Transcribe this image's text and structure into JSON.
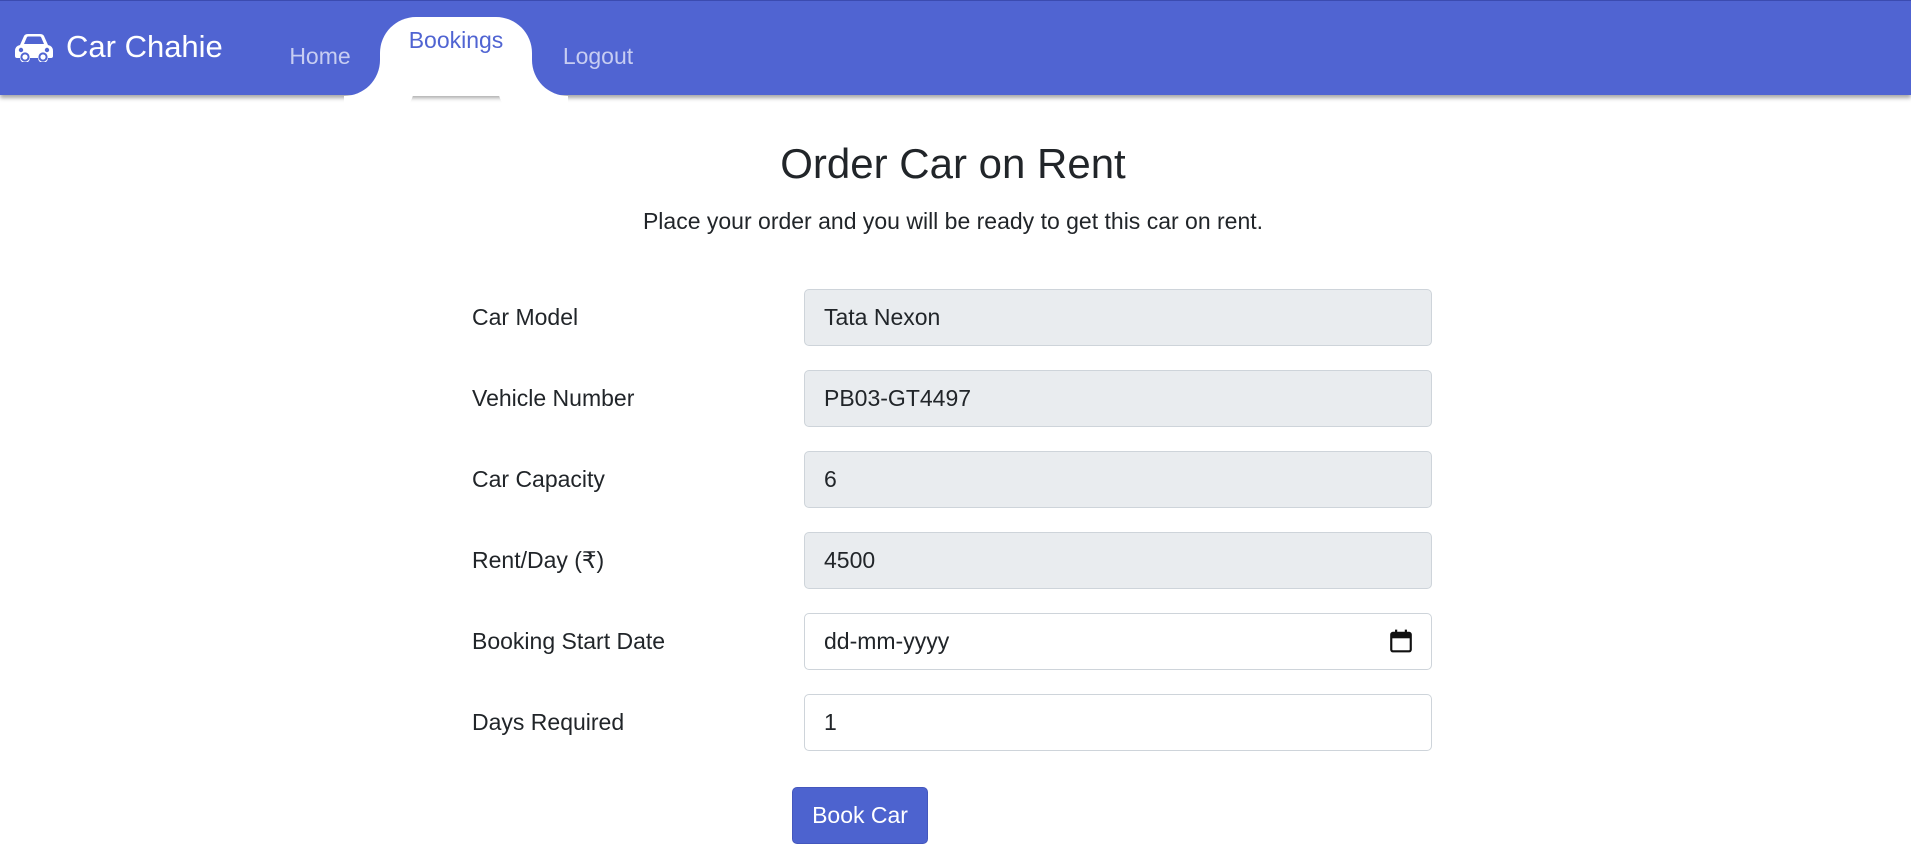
{
  "nav": {
    "brand": "Car Chahie",
    "brand_icon": "car-icon",
    "items": [
      {
        "label": "Home",
        "active": false
      },
      {
        "label": "Bookings",
        "active": true
      },
      {
        "label": "Logout",
        "active": false
      }
    ]
  },
  "colors": {
    "primary": "#5064d2",
    "readonly_bg": "#e9ecef",
    "button": "#4d63cf"
  },
  "page": {
    "title": "Order Car on Rent",
    "subtitle": "Place your order and you will be ready to get this car on rent."
  },
  "form": {
    "fields": [
      {
        "label": "Car Model",
        "value": "Tata Nexon",
        "readonly": true
      },
      {
        "label": "Vehicle Number",
        "value": "PB03-GT4497",
        "readonly": true
      },
      {
        "label": "Car Capacity",
        "value": "6",
        "readonly": true
      },
      {
        "label": "Rent/Day (₹)",
        "value": "4500",
        "readonly": true
      },
      {
        "label": "Booking Start Date",
        "placeholder": "dd-mm-yyyy",
        "icon": "calendar-icon"
      },
      {
        "label": "Days Required",
        "value": "1",
        "readonly": false
      }
    ],
    "submit_label": "Book Car"
  }
}
